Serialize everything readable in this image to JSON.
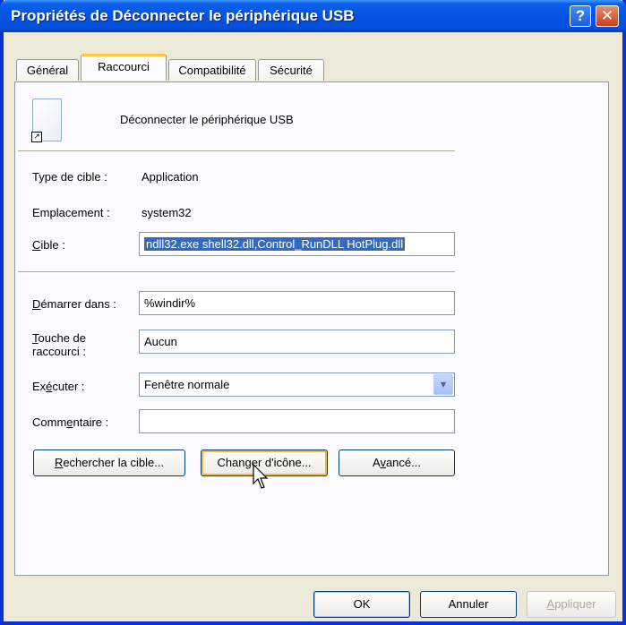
{
  "window": {
    "title": "Propriétés de Déconnecter le périphérique USB",
    "help_glyph": "?",
    "close_glyph": "✕"
  },
  "tabs": [
    {
      "label": "Général",
      "active": false
    },
    {
      "label": "Raccourci",
      "active": true
    },
    {
      "label": "Compatibilité",
      "active": false
    },
    {
      "label": "Sécurité",
      "active": false
    }
  ],
  "shortcut": {
    "name": "Déconnecter le périphérique USB",
    "icon": "document-shortcut-icon"
  },
  "info": {
    "target_type_label": "Type de cible :",
    "target_type_value": "Application",
    "location_label": "Emplacement :",
    "location_value": "system32"
  },
  "fields": {
    "target_label_u": "C",
    "target_label_rest": "ible :",
    "target_value": "ndll32.exe shell32.dll,Control_RunDLL HotPlug.dll",
    "start_in_label_u": "D",
    "start_in_label_rest": "émarrer dans :",
    "start_in_value": "%windir%",
    "hotkey_label_u": "T",
    "hotkey_label_rest": "ouche de",
    "hotkey_label_line2": "raccourci :",
    "hotkey_value": "Aucun",
    "run_label_pre": "Ex",
    "run_label_u": "é",
    "run_label_rest": "cuter :",
    "run_value": "Fenêtre normale",
    "comment_label_pre": "Comm",
    "comment_label_u": "e",
    "comment_label_rest": "ntaire :",
    "comment_value": ""
  },
  "buttons": {
    "find_target_u": "R",
    "find_target_rest": "echercher la cible...",
    "change_icon_pre": "Chan",
    "change_icon_u": "g",
    "change_icon_rest": "er d'icône...",
    "advanced_pre": "A",
    "advanced_u": "v",
    "advanced_rest": "ancé...",
    "ok": "OK",
    "cancel": "Annuler",
    "apply_u": "A",
    "apply_rest": "ppliquer"
  },
  "colors": {
    "titlebar": "#0553E2",
    "selection": "#316AC5",
    "dialog_bg": "#ECE9D8"
  }
}
